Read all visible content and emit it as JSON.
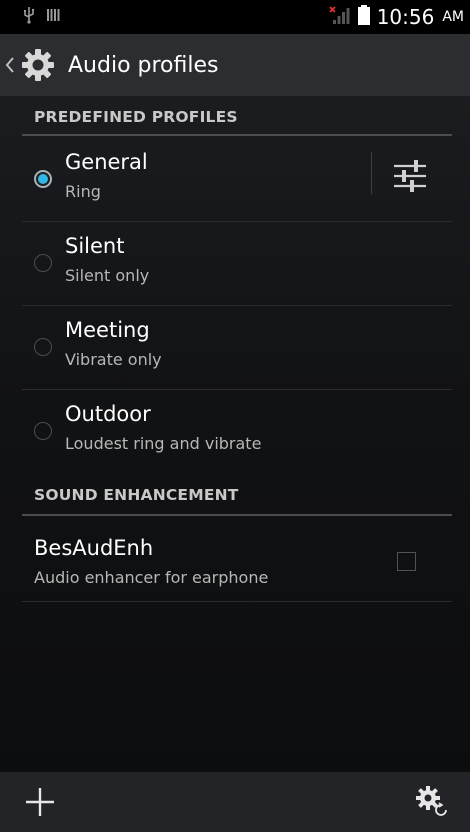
{
  "status_bar": {
    "time": "10:56",
    "ampm": "AM",
    "icons": [
      "usb-icon",
      "storage-bars-icon",
      "no-signal-icon",
      "battery-icon"
    ]
  },
  "action_bar": {
    "title": "Audio profiles",
    "icons": [
      "back-chevron-icon",
      "settings-gear-icon"
    ]
  },
  "sections": {
    "predefined": {
      "header": "PREDEFINED PROFILES",
      "profiles": [
        {
          "title": "General",
          "subtitle": "Ring",
          "selected": true
        },
        {
          "title": "Silent",
          "subtitle": "Silent only",
          "selected": false
        },
        {
          "title": "Meeting",
          "subtitle": "Vibrate only",
          "selected": false
        },
        {
          "title": "Outdoor",
          "subtitle": "Loudest ring and vibrate",
          "selected": false
        }
      ]
    },
    "enhancement": {
      "header": "SOUND ENHANCEMENT",
      "item": {
        "title": "BesAudEnh",
        "subtitle": "Audio enhancer for earphone",
        "checked": false
      }
    }
  },
  "bottom_bar": {
    "icons": [
      "add-icon",
      "reset-settings-icon"
    ]
  },
  "colors": {
    "accent": "#33b5e5",
    "action_bar": "#2b2d30",
    "bottom_bar": "#222427"
  }
}
